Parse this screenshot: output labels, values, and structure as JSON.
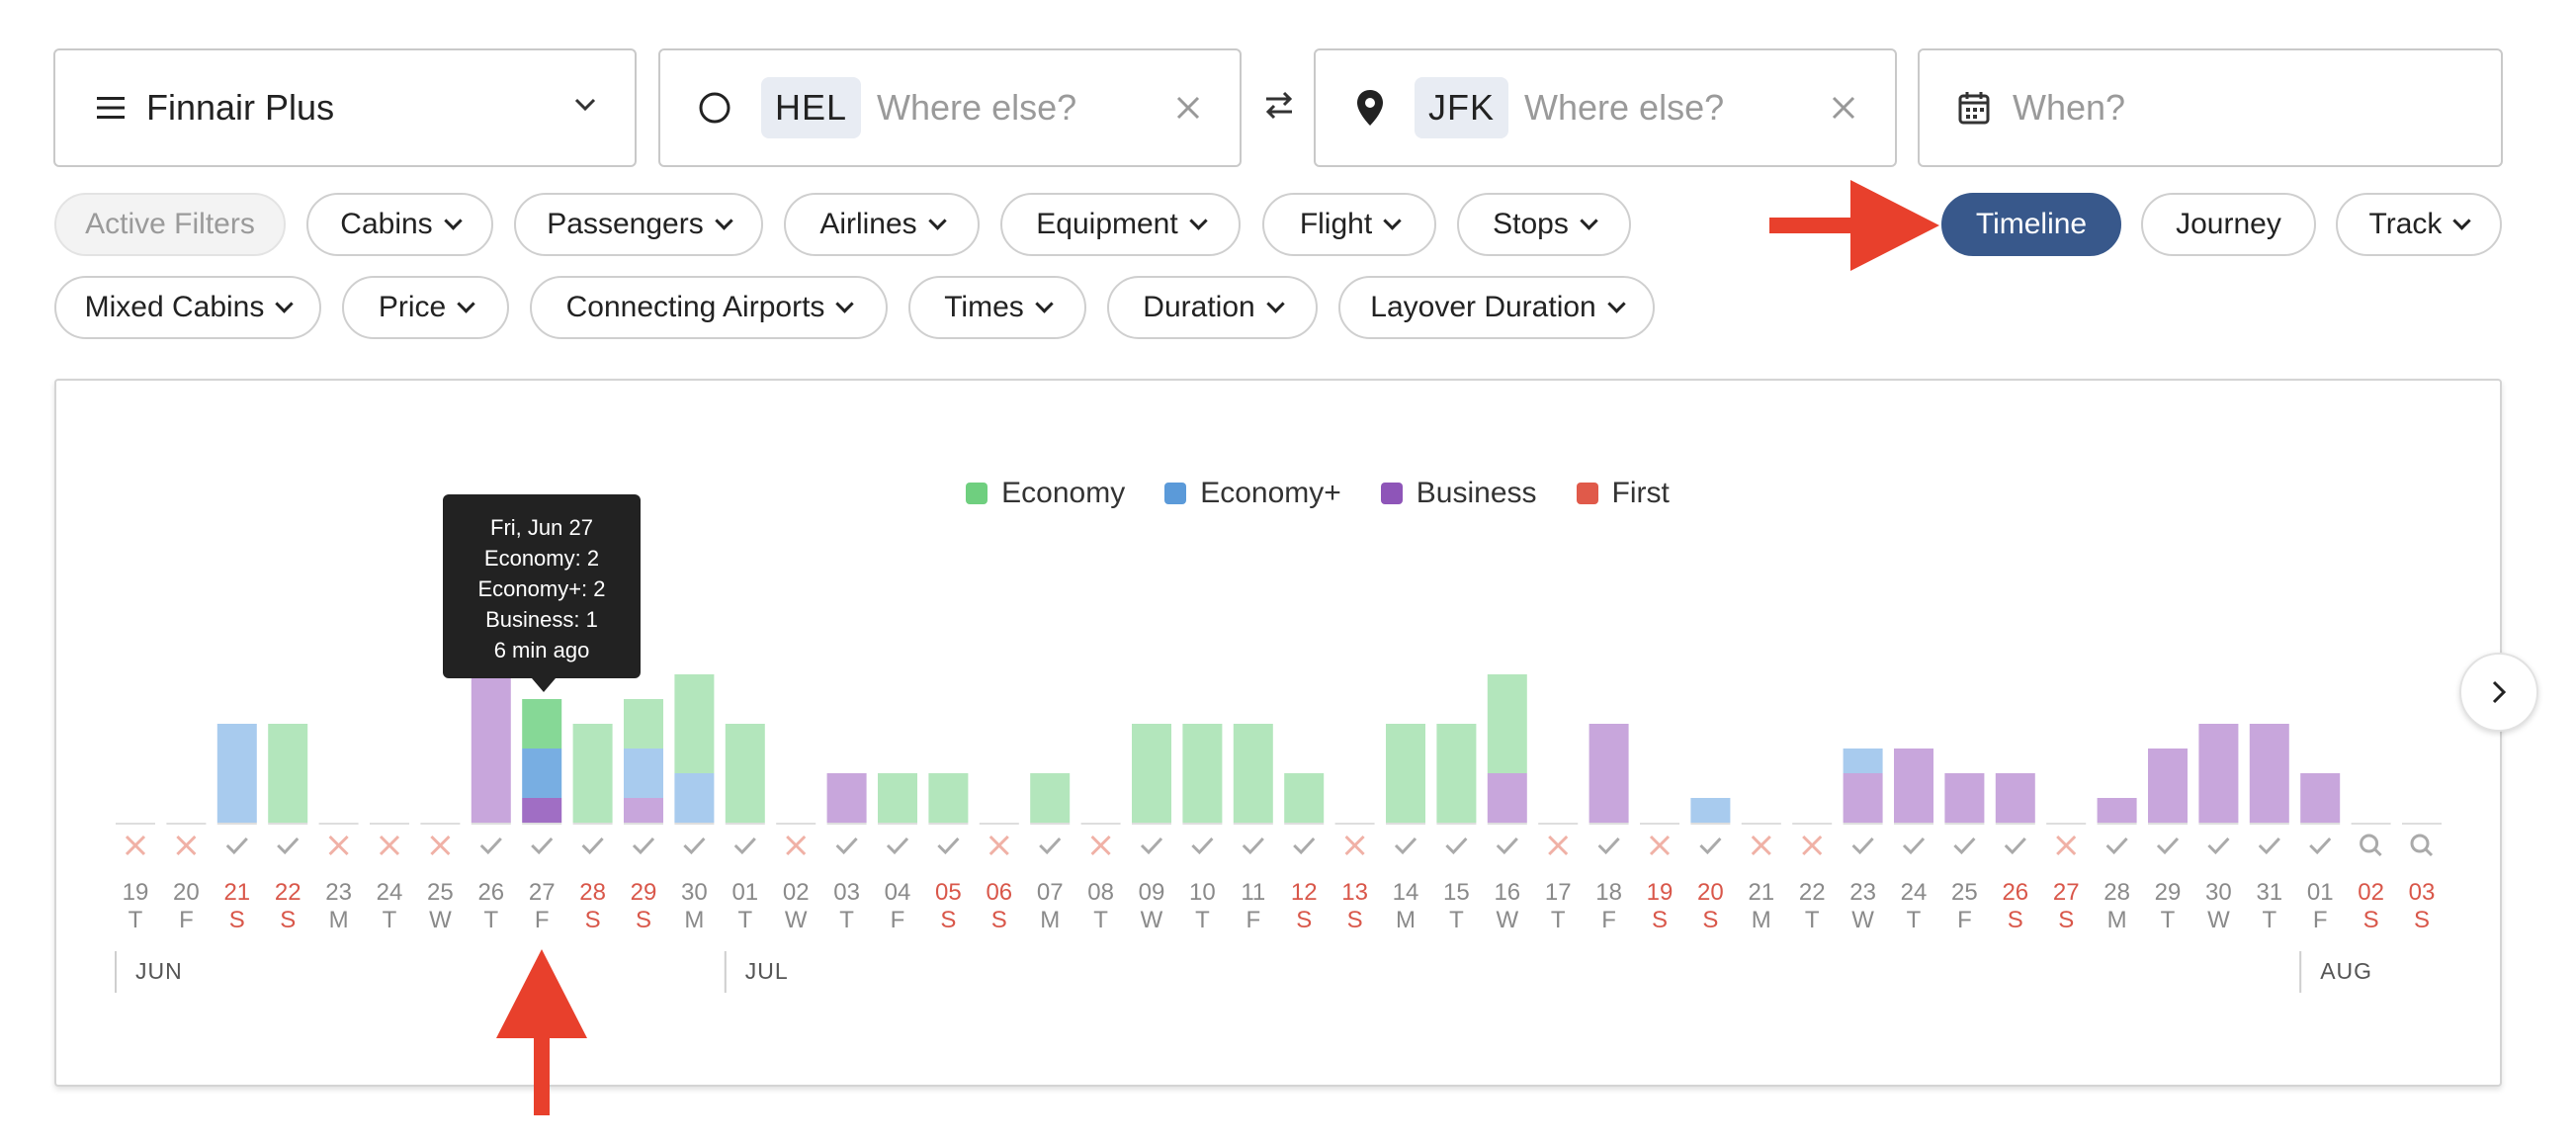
{
  "search": {
    "program": "Finnair Plus",
    "origin_code": "HEL",
    "origin_placeholder": "Where else?",
    "destination_code": "JFK",
    "destination_placeholder": "Where else?",
    "when_placeholder": "When?"
  },
  "filters_row1": [
    "Active Filters",
    "Cabins",
    "Passengers",
    "Airlines",
    "Equipment",
    "Flight",
    "Stops"
  ],
  "views": {
    "timeline": "Timeline",
    "journey": "Journey",
    "track": "Track"
  },
  "filters_row2": [
    "Mixed Cabins",
    "Price",
    "Connecting Airports",
    "Times",
    "Duration",
    "Layover Duration"
  ],
  "colors": {
    "economy": "#6fcf7f",
    "economy_plus": "#5b9ad9",
    "business": "#8e55b8",
    "first": "#e05a4a",
    "weekend": "#d9574a",
    "active_view": "#38588b",
    "annotation": "#e8402c"
  },
  "legend": [
    {
      "label": "Economy",
      "color": "#6fcf7f"
    },
    {
      "label": "Economy+",
      "color": "#5b9ad9"
    },
    {
      "label": "Business",
      "color": "#8e55b8"
    },
    {
      "label": "First",
      "color": "#e05a4a"
    }
  ],
  "tooltip": {
    "date": "Fri, Jun 27",
    "economy": "Economy: 2",
    "economy_plus": "Economy+: 2",
    "business": "Business: 1",
    "updated": "6 min ago"
  },
  "chart_data": {
    "type": "bar",
    "stacked": true,
    "y_scale_note": "seat counts per cabin",
    "series_names": [
      "Economy",
      "Economy+",
      "Business",
      "First"
    ],
    "months": [
      {
        "label": "JUN",
        "start_index": 0
      },
      {
        "label": "JUL",
        "start_index": 12
      },
      {
        "label": "AUG",
        "start_index": 43
      }
    ],
    "days": [
      {
        "d": "19",
        "w": "T",
        "weekend": false,
        "status": "x",
        "economy": 0,
        "economy_plus": 0,
        "business": 0
      },
      {
        "d": "20",
        "w": "F",
        "weekend": false,
        "status": "x",
        "economy": 0,
        "economy_plus": 0,
        "business": 0
      },
      {
        "d": "21",
        "w": "S",
        "weekend": true,
        "status": "check",
        "economy": 0,
        "economy_plus": 4,
        "business": 0
      },
      {
        "d": "22",
        "w": "S",
        "weekend": true,
        "status": "check",
        "economy": 4,
        "economy_plus": 0,
        "business": 0
      },
      {
        "d": "23",
        "w": "M",
        "weekend": false,
        "status": "x",
        "economy": 0,
        "economy_plus": 0,
        "business": 0
      },
      {
        "d": "24",
        "w": "T",
        "weekend": false,
        "status": "x",
        "economy": 0,
        "economy_plus": 0,
        "business": 0
      },
      {
        "d": "25",
        "w": "W",
        "weekend": false,
        "status": "x",
        "economy": 0,
        "economy_plus": 0,
        "business": 0
      },
      {
        "d": "26",
        "w": "T",
        "weekend": false,
        "status": "check",
        "economy": 0,
        "economy_plus": 0,
        "business": 6
      },
      {
        "d": "27",
        "w": "F",
        "weekend": false,
        "status": "check",
        "economy": 2,
        "economy_plus": 2,
        "business": 1,
        "highlight": true
      },
      {
        "d": "28",
        "w": "S",
        "weekend": true,
        "status": "check",
        "economy": 4,
        "economy_plus": 0,
        "business": 0
      },
      {
        "d": "29",
        "w": "S",
        "weekend": true,
        "status": "check",
        "economy": 2,
        "economy_plus": 2,
        "business": 1
      },
      {
        "d": "30",
        "w": "M",
        "weekend": false,
        "status": "check",
        "economy": 4,
        "economy_plus": 2,
        "business": 0
      },
      {
        "d": "01",
        "w": "T",
        "weekend": false,
        "status": "check",
        "economy": 4,
        "economy_plus": 0,
        "business": 0
      },
      {
        "d": "02",
        "w": "W",
        "weekend": false,
        "status": "x",
        "economy": 0,
        "economy_plus": 0,
        "business": 0
      },
      {
        "d": "03",
        "w": "T",
        "weekend": false,
        "status": "check",
        "economy": 0,
        "economy_plus": 0,
        "business": 2
      },
      {
        "d": "04",
        "w": "F",
        "weekend": false,
        "status": "check",
        "economy": 2,
        "economy_plus": 0,
        "business": 0
      },
      {
        "d": "05",
        "w": "S",
        "weekend": true,
        "status": "check",
        "economy": 2,
        "economy_plus": 0,
        "business": 0
      },
      {
        "d": "06",
        "w": "S",
        "weekend": true,
        "status": "x",
        "economy": 0,
        "economy_plus": 0,
        "business": 0
      },
      {
        "d": "07",
        "w": "M",
        "weekend": false,
        "status": "check",
        "economy": 2,
        "economy_plus": 0,
        "business": 0
      },
      {
        "d": "08",
        "w": "T",
        "weekend": false,
        "status": "x",
        "economy": 0,
        "economy_plus": 0,
        "business": 0
      },
      {
        "d": "09",
        "w": "W",
        "weekend": false,
        "status": "check",
        "economy": 4,
        "economy_plus": 0,
        "business": 0
      },
      {
        "d": "10",
        "w": "T",
        "weekend": false,
        "status": "check",
        "economy": 4,
        "economy_plus": 0,
        "business": 0
      },
      {
        "d": "11",
        "w": "F",
        "weekend": false,
        "status": "check",
        "economy": 4,
        "economy_plus": 0,
        "business": 0
      },
      {
        "d": "12",
        "w": "S",
        "weekend": true,
        "status": "check",
        "economy": 2,
        "economy_plus": 0,
        "business": 0
      },
      {
        "d": "13",
        "w": "S",
        "weekend": true,
        "status": "x",
        "economy": 0,
        "economy_plus": 0,
        "business": 0
      },
      {
        "d": "14",
        "w": "M",
        "weekend": false,
        "status": "check",
        "economy": 4,
        "economy_plus": 0,
        "business": 0
      },
      {
        "d": "15",
        "w": "T",
        "weekend": false,
        "status": "check",
        "economy": 4,
        "economy_plus": 0,
        "business": 0
      },
      {
        "d": "16",
        "w": "W",
        "weekend": false,
        "status": "check",
        "economy": 4,
        "economy_plus": 0,
        "business": 2
      },
      {
        "d": "17",
        "w": "T",
        "weekend": false,
        "status": "x",
        "economy": 0,
        "economy_plus": 0,
        "business": 0
      },
      {
        "d": "18",
        "w": "F",
        "weekend": false,
        "status": "check",
        "economy": 0,
        "economy_plus": 0,
        "business": 4
      },
      {
        "d": "19",
        "w": "S",
        "weekend": true,
        "status": "x",
        "economy": 0,
        "economy_plus": 0,
        "business": 0
      },
      {
        "d": "20",
        "w": "S",
        "weekend": true,
        "status": "check",
        "economy": 0,
        "economy_plus": 1,
        "business": 0
      },
      {
        "d": "21",
        "w": "M",
        "weekend": false,
        "status": "x",
        "economy": 0,
        "economy_plus": 0,
        "business": 0
      },
      {
        "d": "22",
        "w": "T",
        "weekend": false,
        "status": "x",
        "economy": 0,
        "economy_plus": 0,
        "business": 0
      },
      {
        "d": "23",
        "w": "W",
        "weekend": false,
        "status": "check",
        "economy": 0,
        "economy_plus": 1,
        "business": 2
      },
      {
        "d": "24",
        "w": "T",
        "weekend": false,
        "status": "check",
        "economy": 0,
        "economy_plus": 0,
        "business": 3
      },
      {
        "d": "25",
        "w": "F",
        "weekend": false,
        "status": "check",
        "economy": 0,
        "economy_plus": 0,
        "business": 2
      },
      {
        "d": "26",
        "w": "S",
        "weekend": true,
        "status": "check",
        "economy": 0,
        "economy_plus": 0,
        "business": 2
      },
      {
        "d": "27",
        "w": "S",
        "weekend": true,
        "status": "x",
        "economy": 0,
        "economy_plus": 0,
        "business": 0
      },
      {
        "d": "28",
        "w": "M",
        "weekend": false,
        "status": "check",
        "economy": 0,
        "economy_plus": 0,
        "business": 1
      },
      {
        "d": "29",
        "w": "T",
        "weekend": false,
        "status": "check",
        "economy": 0,
        "economy_plus": 0,
        "business": 3
      },
      {
        "d": "30",
        "w": "W",
        "weekend": false,
        "status": "check",
        "economy": 0,
        "economy_plus": 0,
        "business": 4
      },
      {
        "d": "31",
        "w": "T",
        "weekend": false,
        "status": "check",
        "economy": 0,
        "economy_plus": 0,
        "business": 4
      },
      {
        "d": "01",
        "w": "F",
        "weekend": false,
        "status": "check",
        "economy": 0,
        "economy_plus": 0,
        "business": 2
      },
      {
        "d": "02",
        "w": "S",
        "weekend": true,
        "status": "search",
        "economy": 0,
        "economy_plus": 0,
        "business": 0
      },
      {
        "d": "03",
        "w": "S",
        "weekend": true,
        "status": "search",
        "economy": 0,
        "economy_plus": 0,
        "business": 0
      }
    ]
  }
}
